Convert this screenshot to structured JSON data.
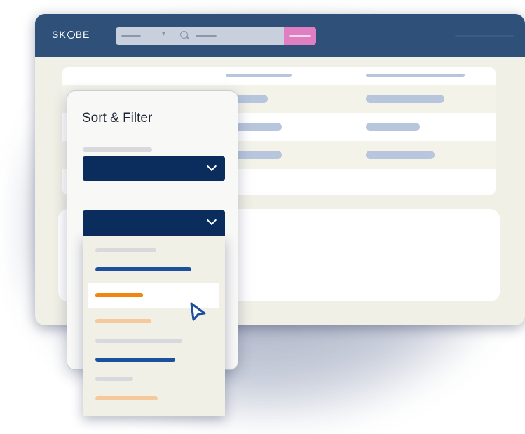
{
  "app": {
    "logo_text": [
      "SK",
      "BE"
    ],
    "brand_colors": {
      "topbar": "#2f5079",
      "navy": "#0b2d5d",
      "search_button": "#e07ec2",
      "accent_orange": "#f0860f",
      "accent_blue": "#1c4f9c"
    }
  },
  "search": {
    "icon": "search-icon",
    "select_icon": "chevron-down-icon"
  },
  "filter_panel": {
    "title": "Sort & Filter",
    "select_icon": "chevron-down-icon",
    "highlighted_option_index": 2
  },
  "cursor": {
    "icon": "pointer-cursor-icon"
  }
}
